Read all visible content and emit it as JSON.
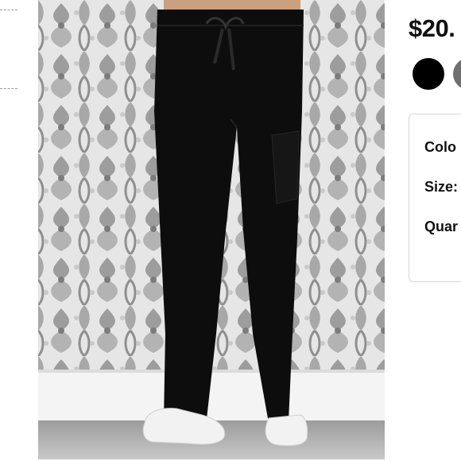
{
  "product": {
    "price": "$20.",
    "color_swatches": [
      {
        "name": "black",
        "color": "#000000",
        "selected": true
      },
      {
        "name": "grey",
        "color": "#707070",
        "selected": false
      }
    ]
  },
  "options": {
    "color_label": "Colo",
    "size_label": "Size:",
    "quantity_label": "Quar"
  }
}
